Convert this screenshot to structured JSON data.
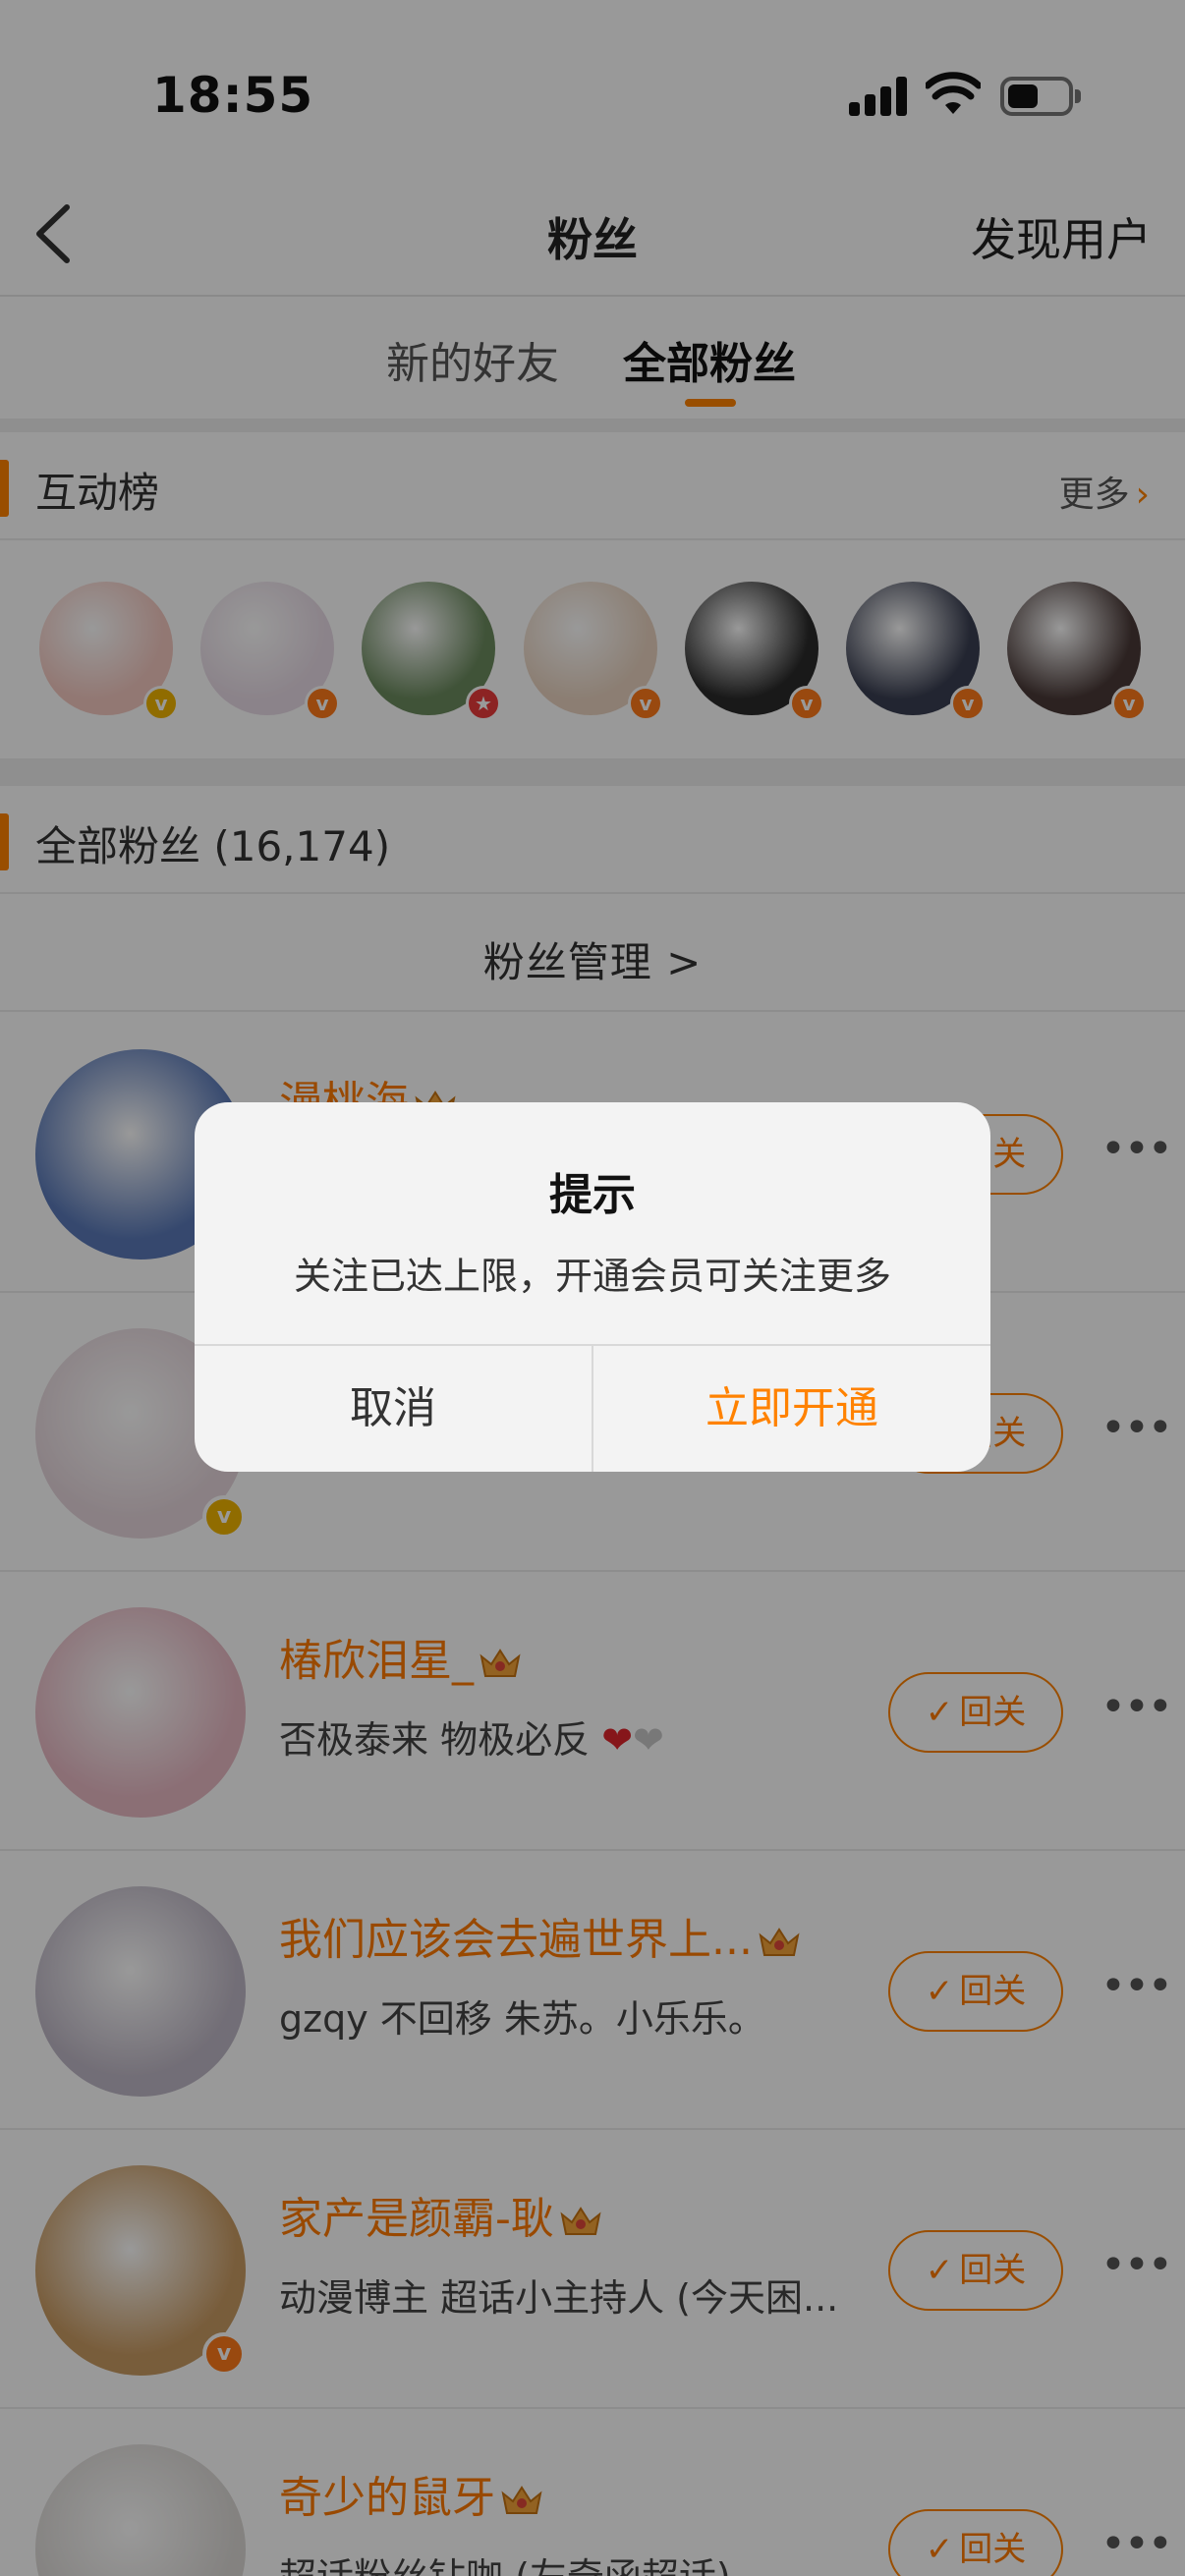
{
  "status_bar": {
    "time": "18:55"
  },
  "nav": {
    "title": "粉丝",
    "right_action": "发现用户"
  },
  "tabs": [
    {
      "label": "新的好友",
      "active": false
    },
    {
      "label": "全部粉丝",
      "active": true
    }
  ],
  "interaction": {
    "title": "互动榜",
    "more": "更多",
    "avatars": [
      {
        "color": "#f4c8c0",
        "badge": "gold"
      },
      {
        "color": "#e8dbe6",
        "badge": "orange"
      },
      {
        "color": "#6b8a5e",
        "badge": "red"
      },
      {
        "color": "#e9d3c0",
        "badge": "orange"
      },
      {
        "color": "#2a2a2a",
        "badge": "orange"
      },
      {
        "color": "#3a3f52",
        "badge": "orange"
      },
      {
        "color": "#4a3a38",
        "badge": "orange"
      }
    ]
  },
  "all_fans": {
    "title": "全部粉丝 (16,174)",
    "manage": "粉丝管理 >"
  },
  "fans": [
    {
      "name": "漫桃海",
      "desc": "",
      "button": "回关",
      "avatar_color": "#5a79b8",
      "badge": ""
    },
    {
      "name": "",
      "desc": "",
      "button": "回关",
      "avatar_color": "#e6d6dc",
      "badge": "gold"
    },
    {
      "name": "椿欣泪星_",
      "desc": "否极泰来 物极必反",
      "button": "回关",
      "avatar_color": "#e8b9c4",
      "badge": ""
    },
    {
      "name": "我们应该会去遍世界上...",
      "desc": "gzqy 不回移 朱苏。小乐乐。",
      "button": "回关",
      "avatar_color": "#bfb8c6",
      "badge": ""
    },
    {
      "name": "家产是颜霸-耿",
      "desc": "动漫博主 超话小主持人 (今天困...",
      "button": "回关",
      "avatar_color": "#c99b63",
      "badge": "orange"
    },
    {
      "name": "奇少的鼠牙",
      "desc": "超话粉丝钻咖 (左奇函超话)",
      "button": "回关",
      "avatar_color": "#dcd9d6",
      "badge": ""
    }
  ],
  "dialog": {
    "title": "提示",
    "message": "关注已达上限，开通会员可关注更多",
    "cancel": "取消",
    "confirm": "立即开通"
  },
  "colors": {
    "accent": "#ff8200",
    "name": "#ff7a00"
  }
}
